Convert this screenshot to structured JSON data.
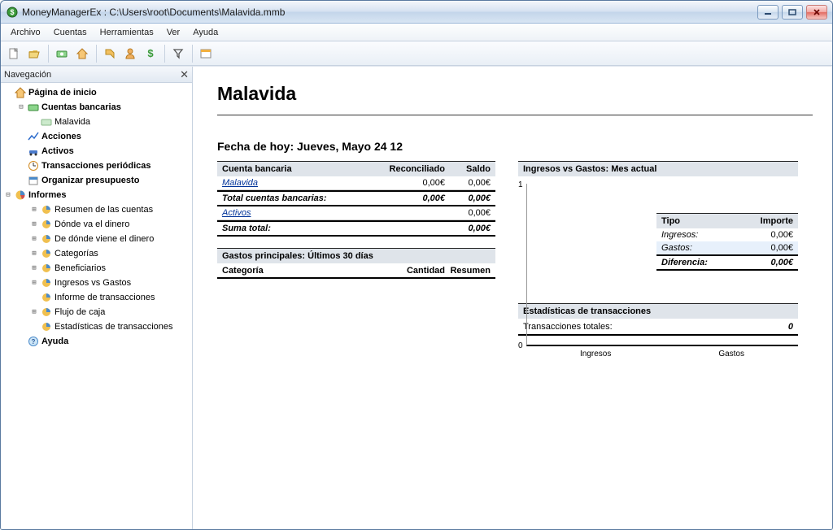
{
  "window": {
    "title": "MoneyManagerEx : C:\\Users\\root\\Documents\\Malavida.mmb"
  },
  "menu": {
    "file": "Archivo",
    "accounts": "Cuentas",
    "tools": "Herramientas",
    "view": "Ver",
    "help": "Ayuda"
  },
  "nav": {
    "header": "Navegación",
    "home": "Página de inicio",
    "bank_accounts": "Cuentas bancarias",
    "account1": "Malavida",
    "stocks": "Acciones",
    "assets": "Activos",
    "recurring": "Transacciones periódicas",
    "budget": "Organizar presupuesto",
    "reports": "Informes",
    "r_summary": "Resumen de las cuentas",
    "r_wheremoney": "Dónde va el dinero",
    "r_wherecomes": "De dónde viene el dinero",
    "r_categories": "Categorías",
    "r_payees": "Beneficiarios",
    "r_incvsexp": "Ingresos vs Gastos",
    "r_txn_report": "Informe de transacciones",
    "r_cashflow": "Flujo de caja",
    "r_txn_stats": "Estadísticas de transacciones",
    "help": "Ayuda"
  },
  "page": {
    "title": "Malavida",
    "today_label": "Fecha de hoy: Jueves, Mayo 24 12"
  },
  "accounts_table": {
    "h1": "Cuenta bancaria",
    "h2": "Reconciliado",
    "h3": "Saldo",
    "row1_name": "Malavida",
    "row1_rec": "0,00€",
    "row1_bal": "0,00€",
    "total_label": "Total cuentas bancarias:",
    "total_rec": "0,00€",
    "total_bal": "0,00€",
    "assets_label": "Activos",
    "assets_bal": "0,00€",
    "sum_label": "Suma total:",
    "sum_bal": "0,00€"
  },
  "expenses": {
    "header": "Gastos principales: Últimos 30 días",
    "c1": "Categoría",
    "c2": "Cantidad",
    "c3": "Resumen"
  },
  "ive": {
    "header": "Ingresos vs Gastos: Mes actual",
    "type_h": "Tipo",
    "amount_h": "Importe",
    "income_l": "Ingresos:",
    "income_v": "0,00€",
    "expense_l": "Gastos:",
    "expense_v": "0,00€",
    "diff_l": "Diferencia:",
    "diff_v": "0,00€",
    "x1": "Ingresos",
    "x2": "Gastos"
  },
  "stats": {
    "header": "Estadísticas de transacciones",
    "total_l": "Transacciones totales:",
    "total_v": "0"
  },
  "chart_data": {
    "type": "bar",
    "categories": [
      "Ingresos",
      "Gastos"
    ],
    "values": [
      0,
      0
    ],
    "ylim": [
      0,
      1
    ]
  }
}
